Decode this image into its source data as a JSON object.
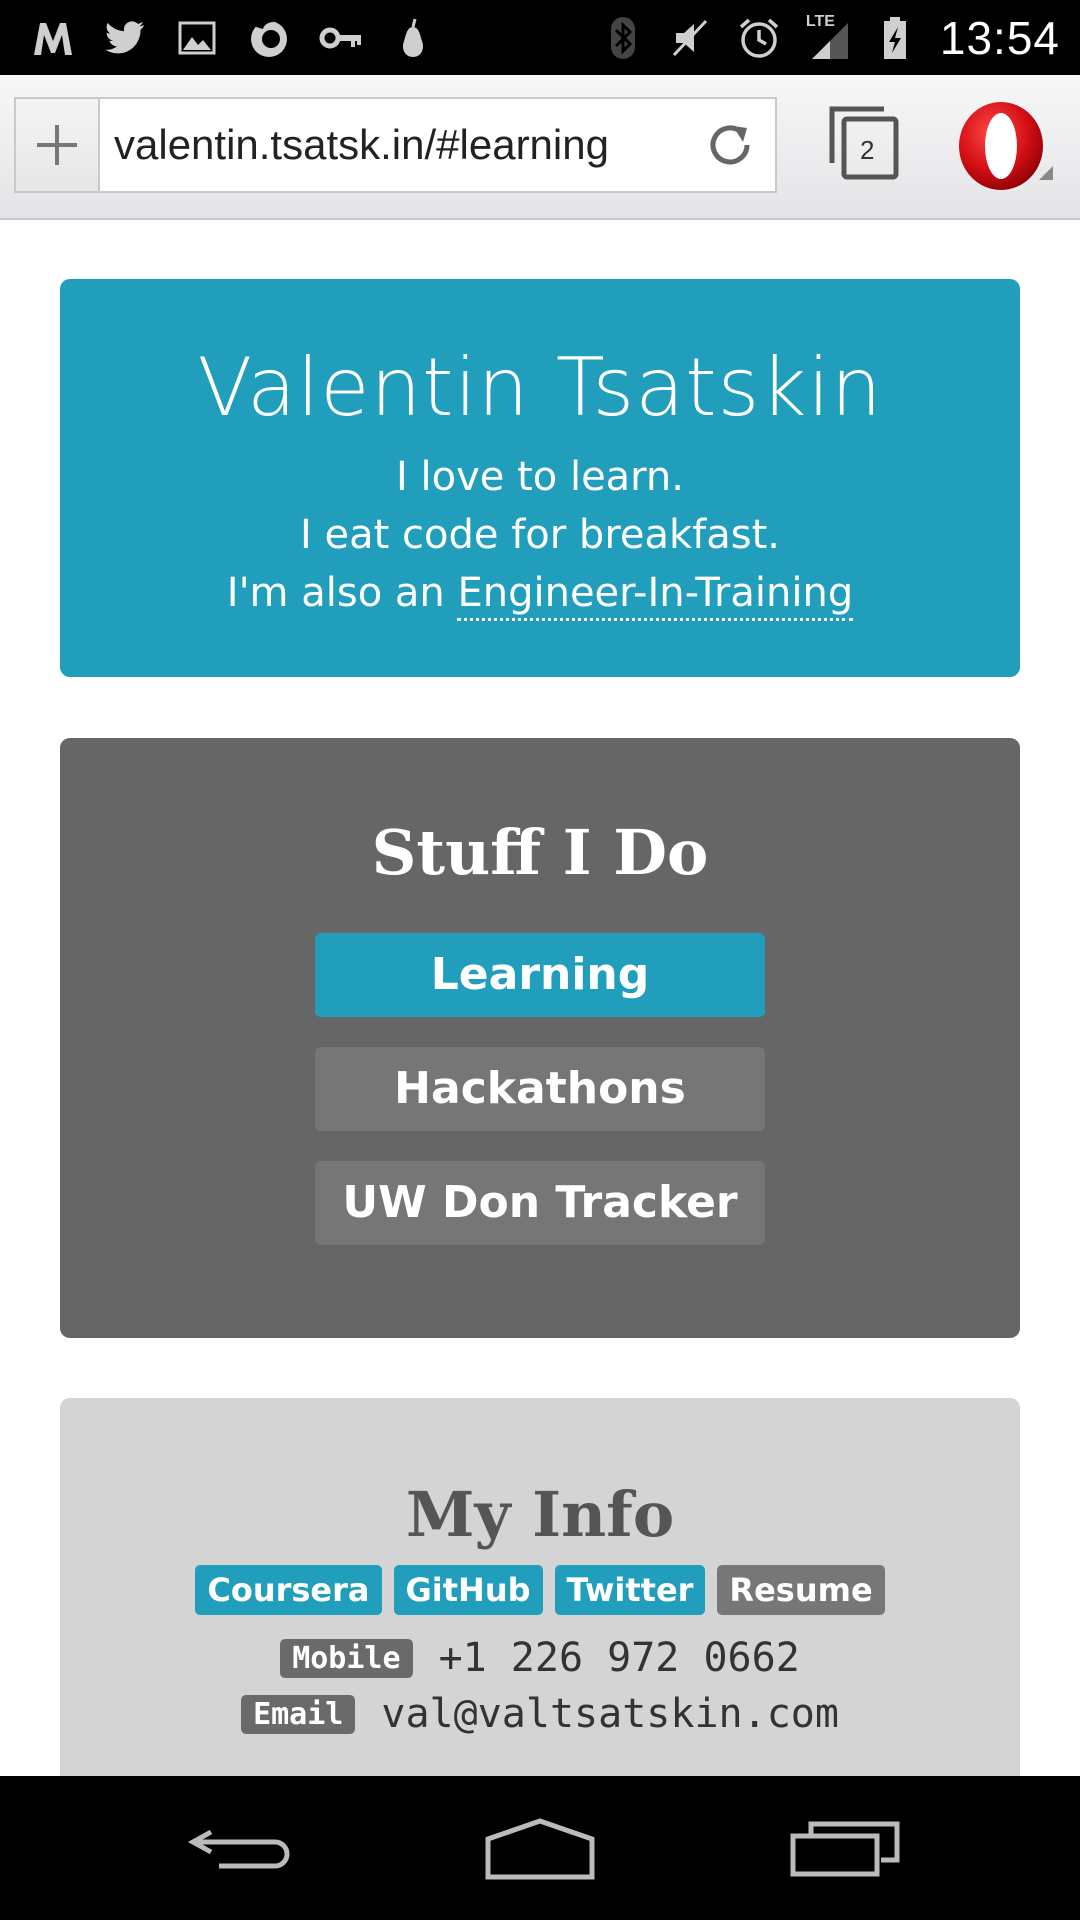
{
  "status_bar": {
    "time": "13:54",
    "left_icons": [
      "metro-icon",
      "twitter-icon",
      "image-icon",
      "firefox-icon",
      "key-icon",
      "pear-icon"
    ],
    "right_icons": [
      "bluetooth-icon",
      "mute-icon",
      "alarm-icon",
      "lte-signal-icon",
      "battery-charging-icon"
    ],
    "network_label": "LTE"
  },
  "browser": {
    "url": "valentin.tsatsk.in/#learning",
    "tab_count": "2"
  },
  "hero": {
    "name": "Valentin Tsatskin",
    "line1": "I love to learn.",
    "line2": "I eat code for breakfast.",
    "line3_prefix": "I'm also an ",
    "line3_link": "Engineer-In-Training"
  },
  "stuff": {
    "title": "Stuff I Do",
    "buttons": [
      {
        "label": "Learning",
        "active": true
      },
      {
        "label": "Hackathons",
        "active": false
      },
      {
        "label": "UW Don Tracker",
        "active": false
      }
    ]
  },
  "info": {
    "title": "My Info",
    "links": [
      "Coursera",
      "GitHub",
      "Twitter",
      "Resume"
    ],
    "mobile_label": "Mobile",
    "mobile_value": "+1 226 972 0662",
    "email_label": "Email",
    "email_value": "val@valtsatskin.com"
  },
  "colors": {
    "accent": "#219ebc",
    "stuff_bg": "#666666",
    "info_bg": "#d4d4d4"
  }
}
